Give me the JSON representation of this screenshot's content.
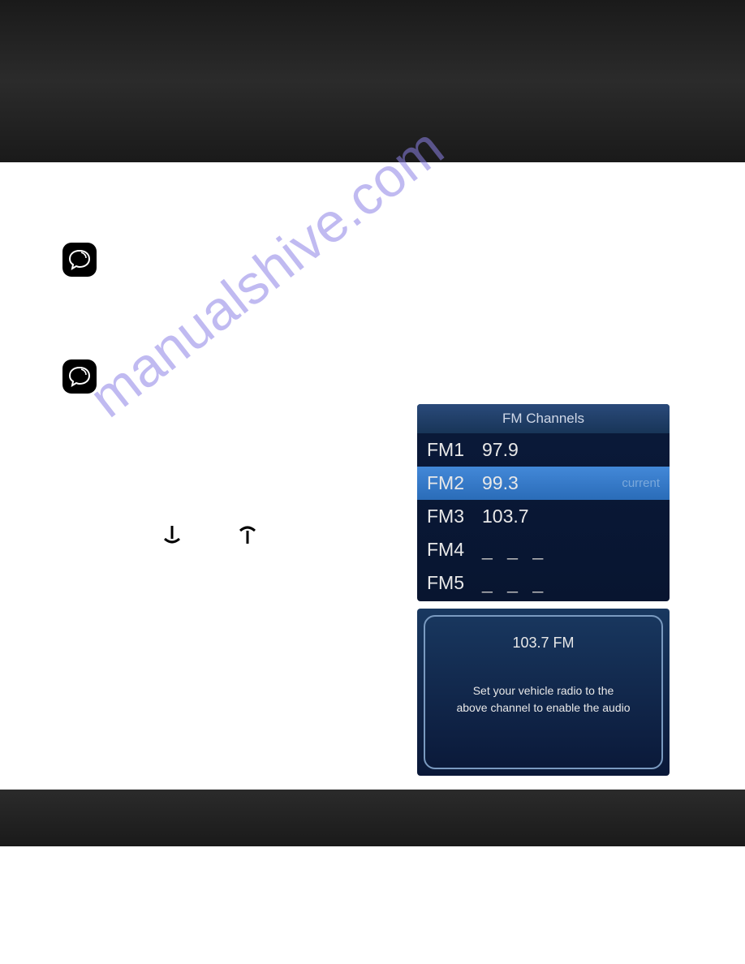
{
  "fm_channels": {
    "header": "FM Channels",
    "rows": [
      {
        "label": "FM1",
        "value": "97.9",
        "current": false
      },
      {
        "label": "FM2",
        "value": "99.3",
        "current": true
      },
      {
        "label": "FM3",
        "value": "103.7",
        "current": false
      },
      {
        "label": "FM4",
        "value": "_ _ _",
        "current": false
      },
      {
        "label": "FM5",
        "value": "_ _ _",
        "current": false
      }
    ],
    "current_label": "current"
  },
  "info_panel": {
    "frequency": "103.7 FM",
    "message_line1": "Set your vehicle radio to the",
    "message_line2": "above channel to enable the audio"
  },
  "watermark": "manualshive.com"
}
